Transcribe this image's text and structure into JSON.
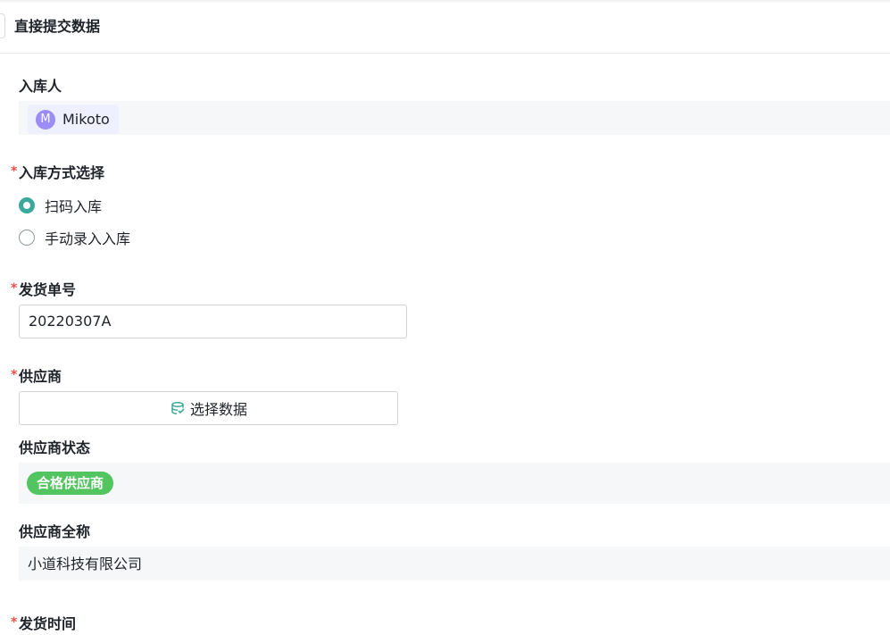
{
  "header": {
    "title": "直接提交数据"
  },
  "fields": {
    "warehouser": {
      "label": "入库人",
      "avatar_initial": "M",
      "user_name": "Mikoto"
    },
    "method": {
      "label": "入库方式选择",
      "options": [
        {
          "label": "扫码入库",
          "checked": true
        },
        {
          "label": "手动录入入库",
          "checked": false
        }
      ]
    },
    "shipment_no": {
      "label": "发货单号",
      "value": "20220307A"
    },
    "supplier": {
      "label": "供应商",
      "button_label": "选择数据",
      "button_icon": "database-select-icon"
    },
    "supplier_status": {
      "label": "供应商状态",
      "value": "合格供应商"
    },
    "supplier_fullname": {
      "label": "供应商全称",
      "value": "小道科技有限公司"
    },
    "ship_time": {
      "label": "发货时间"
    }
  },
  "colors": {
    "accent": "#3aa89a",
    "required": "#f54a45",
    "tag_green": "#52c460",
    "avatar": "#9c8cf7",
    "readonly_bg": "#f6f7f8"
  }
}
